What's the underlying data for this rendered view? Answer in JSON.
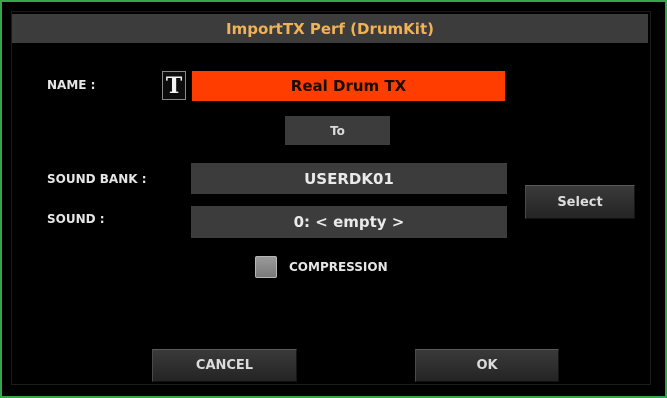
{
  "dialog": {
    "title": "ImportTX Perf (DrumKit)"
  },
  "name": {
    "label": "NAME :",
    "value": "Real Drum TX",
    "text_icon": "T"
  },
  "to_button": "To",
  "sound_bank": {
    "label": "SOUND BANK :",
    "value": "USERDK01"
  },
  "sound": {
    "label": "SOUND :",
    "value": "0: < empty >"
  },
  "select_button": "Select",
  "compression": {
    "label": "COMPRESSION",
    "checked": false
  },
  "footer": {
    "cancel_label": "CANCEL",
    "ok_label": "OK"
  },
  "colors": {
    "title_text": "#f0b254",
    "name_field": "#ff3d00",
    "field_bg": "#3c3c3c",
    "frame_border": "#37a64a"
  }
}
